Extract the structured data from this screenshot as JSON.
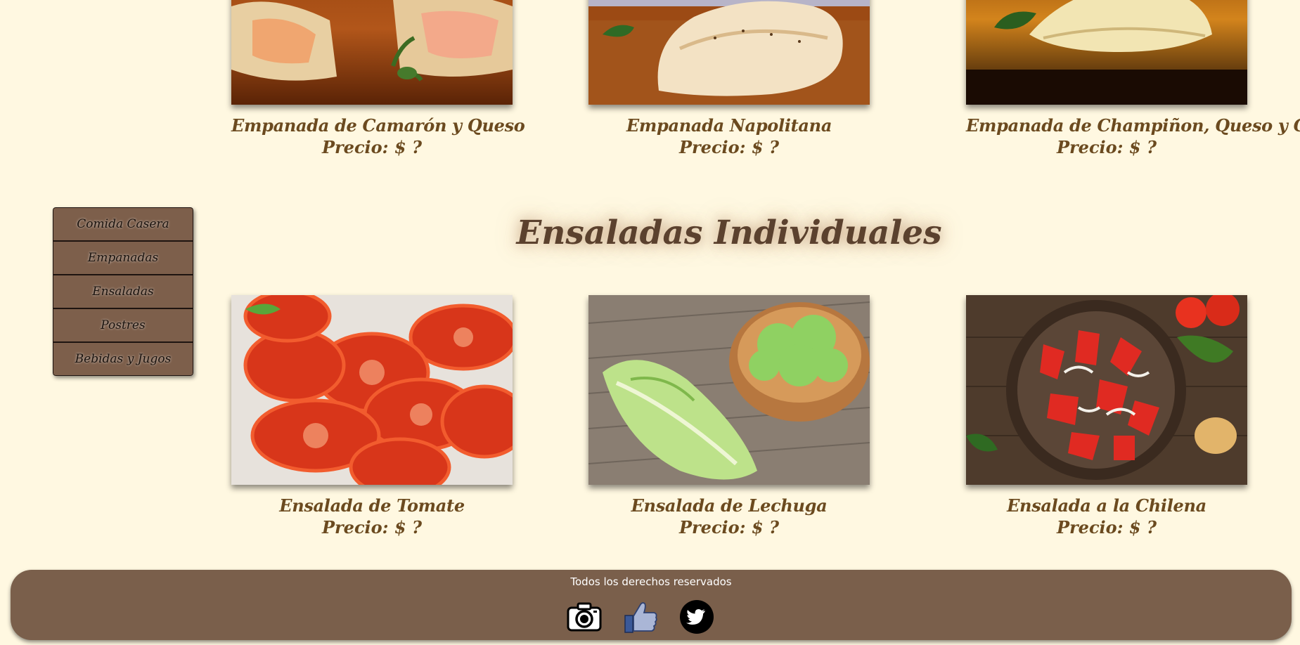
{
  "sidebar": {
    "items": [
      {
        "label": "Comida Casera"
      },
      {
        "label": "Empanadas"
      },
      {
        "label": "Ensaladas"
      },
      {
        "label": "Postres"
      },
      {
        "label": "Bebidas y Jugos"
      }
    ]
  },
  "empanadas": {
    "items": [
      {
        "name": "Empanada de Camarón y Queso",
        "price": "Precio: $ ?"
      },
      {
        "name": "Empanada Napolitana",
        "price": "Precio: $ ?"
      },
      {
        "name": "Empanada de Champiñon, Queso y Choclo",
        "price": "Precio: $ ?"
      }
    ]
  },
  "ensaladas": {
    "title": "Ensaladas Individuales",
    "items": [
      {
        "name": "Ensalada de Tomate",
        "price": "Precio: $ ?"
      },
      {
        "name": "Ensalada de Lechuga",
        "price": "Precio: $ ?"
      },
      {
        "name": "Ensalada a la Chilena",
        "price": "Precio: $ ?"
      }
    ]
  },
  "footer": {
    "text": "Todos los derechos reservados",
    "icons": [
      "camera-icon",
      "thumbs-up-icon",
      "twitter-bird-icon"
    ]
  },
  "colors": {
    "background": "#fff8e1",
    "sidebar": "#7d5f4b",
    "footer": "#7a5f4b",
    "text_brown": "#6b4a1f",
    "title_brown": "#5b412e"
  }
}
